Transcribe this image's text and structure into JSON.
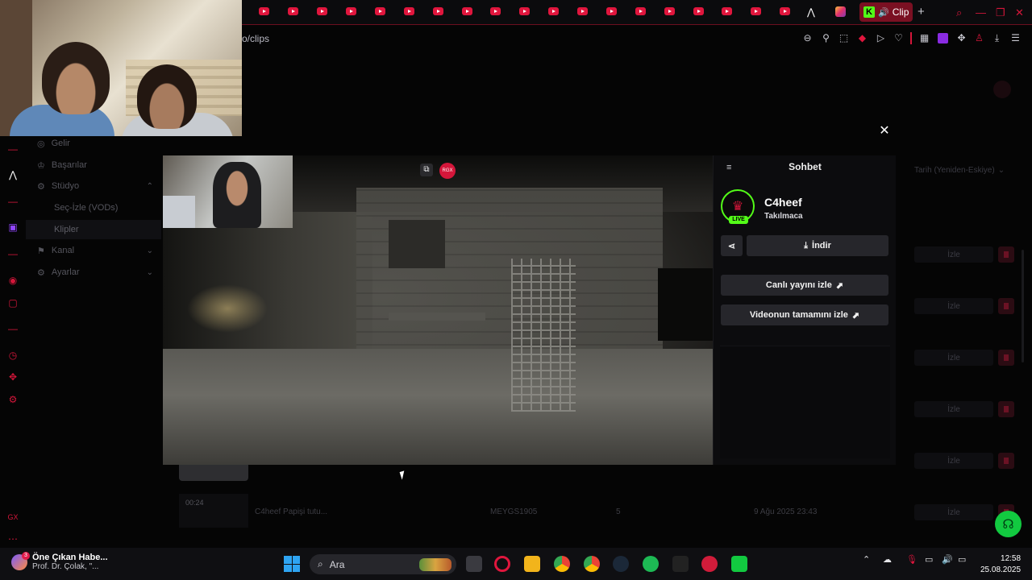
{
  "browser": {
    "active_tab_label": "Clip",
    "url": "o/clips"
  },
  "sidebar": {
    "items": [
      {
        "label": "Gelir"
      },
      {
        "label": "Başarılar"
      },
      {
        "label": "Stüdyo"
      },
      {
        "label": "Seç-İzle (VODs)"
      },
      {
        "label": "Klipler"
      },
      {
        "label": "Kanal"
      },
      {
        "label": "Ayarlar"
      }
    ]
  },
  "page": {
    "sort_label": "Tarih (Yeniden-Eskiye)",
    "watch_label": "İzle",
    "clip_row": {
      "duration": "00:24",
      "title": "C4heef Papişi tutu...",
      "clipper": "MEYGS1905",
      "views": "5",
      "date": "9 Ağu 2025 23:43"
    }
  },
  "player": {
    "badge": "RGX"
  },
  "chat_panel": {
    "title": "Sohbet",
    "streamer": "C4heef",
    "category": "Takılmaca",
    "live_badge": "LIVE",
    "download_label": "İndir",
    "watch_live_label": "Canlı yayını izle",
    "watch_full_label": "Videonun tamamını izle"
  },
  "taskbar": {
    "news_badge": "3",
    "news_title": "Öne Çıkan Habe...",
    "news_sub": "Prof. Dr. Çolak, \"...",
    "search_placeholder": "Ara",
    "time": "12:58",
    "date": "25.08.2025"
  },
  "colors": {
    "accent": "#e0163d",
    "kick_green": "#53fc18",
    "help_green": "#12c940"
  }
}
